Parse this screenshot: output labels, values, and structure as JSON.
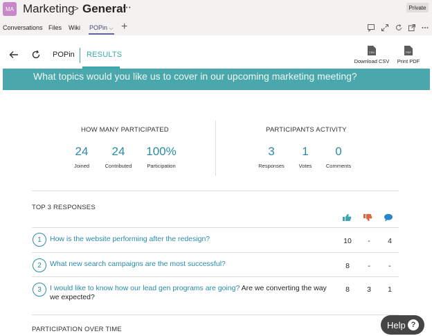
{
  "header": {
    "avatar_initials": "MA",
    "team": "Marketing",
    "separator": ">",
    "channel": "General",
    "more": "···",
    "badge": "Private"
  },
  "tabs": {
    "items": [
      {
        "label": "Conversations"
      },
      {
        "label": "Files"
      },
      {
        "label": "Wiki"
      },
      {
        "label": "POPin"
      }
    ],
    "chevron": "⌵",
    "add": "+"
  },
  "toolbar": {
    "app_name": "POPin",
    "results_tab": "RESULTS",
    "download_csv": "Download CSV",
    "print_pdf": "Print PDF",
    "csv_tag": "CSV",
    "pdf_tag": "PDF"
  },
  "question": "What topics would you like us to cover in our upcoming marketing meeting?",
  "participation": {
    "heading": "HOW MANY PARTICIPATED",
    "stats": [
      {
        "value": "24",
        "label": "Joined"
      },
      {
        "value": "24",
        "label": "Contributed"
      },
      {
        "value": "100%",
        "label": "Participation"
      }
    ]
  },
  "activity": {
    "heading": "PARTICIPANTS ACTIVITY",
    "stats": [
      {
        "value": "3",
        "label": "Responses"
      },
      {
        "value": "1",
        "label": "Votes"
      },
      {
        "value": "0",
        "label": "Comments"
      }
    ]
  },
  "top_responses": {
    "heading": "TOP 3 RESPONSES",
    "columns": [
      "thumbs-up-icon",
      "thumbs-down-icon",
      "comment-icon"
    ],
    "colors": {
      "up": "#3aa8ad",
      "down": "#e2633f",
      "comment": "#2a86c9"
    },
    "rows": [
      {
        "rank": "1",
        "link": "How is the website performing after the redesign?",
        "rest": "",
        "up": "10",
        "down": "-",
        "comments": "4"
      },
      {
        "rank": "2",
        "link": "What new search campaigns are the most successful?",
        "rest": "",
        "up": "8",
        "down": "-",
        "comments": "-"
      },
      {
        "rank": "3",
        "link": "I would like to know how our lead gen programs are going?",
        "rest": " Are we converting the way we expected?",
        "up": "8",
        "down": "3",
        "comments": "1"
      }
    ]
  },
  "over_time": {
    "heading": "PARTICIPATION OVER TIME"
  },
  "help": {
    "label": "Help",
    "glyph": "?"
  },
  "theme": {
    "accent": "#3aa8ad",
    "number_color": "#2a8aa8",
    "teams_purple": "#6264a7"
  }
}
